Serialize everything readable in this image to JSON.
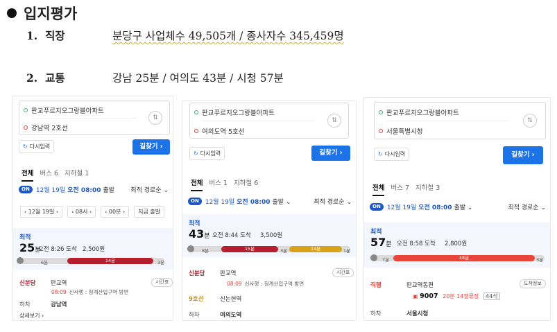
{
  "section": {
    "title": "입지평가"
  },
  "rows": [
    {
      "num": "1.",
      "label": "직장",
      "text": "분당구 사업체수 49,505개 / 종사자수 345,459명"
    },
    {
      "num": "2.",
      "label": "교통",
      "text": "강남 25분 / 여의도 43분 / 시청 57분"
    }
  ],
  "panels": [
    {
      "origin": "판교푸르지오그랑블아파트",
      "dest": "강남역 2호선",
      "reset": "다시입력",
      "find": "길찾기 ›",
      "tabs": [
        "전체",
        "버스 6",
        "지하철 1"
      ],
      "date": "12월 19일",
      "time": "오전 08:00",
      "suffix": "출발",
      "on": "ON",
      "sort": "최적 경로순 ⌄",
      "time_controls": [
        "‹  12월 19일  ›",
        "‹  08시  ›",
        "‹  00분  ›",
        "지금 출발"
      ],
      "best": "최적",
      "dur_num": "25",
      "dur_unit": "분",
      "arrive": "오전 8:26 도착",
      "fare": "2,500원",
      "seg_walk1": "6분",
      "seg_main": "14분",
      "seg_walk2": "3분",
      "main_color": "#b5202e",
      "stop1_line": "신분당",
      "stop1_name": "판교역",
      "stop1_chip": "시간표",
      "stop1_sub_time": "08:09",
      "stop1_sub": "신사행 : 청계산입구역 방면",
      "stop2_line": "하차",
      "stop2_name": "강남역",
      "more": "상세보기 ›"
    },
    {
      "origin": "판교푸르지오그랑블아파트",
      "dest": "여의도역 5호선",
      "reset": "다시입력",
      "find": "길찾기 ›",
      "tabs": [
        "전체",
        "버스 1",
        "지하철 6"
      ],
      "date": "12월 19일",
      "time": "오전 08:00",
      "suffix": "출발 ⌄",
      "on": "ON",
      "sort": "최적 경로순 ⌄",
      "best": "최적",
      "dur_num": "43",
      "dur_unit": "분",
      "arrive": "오전 8:44 도착",
      "fare": "3,500원",
      "seg_walk1": "8분",
      "seg_main": "15분",
      "seg_walk2": "3분",
      "seg_main2": "14분",
      "seg_walk3": "1분",
      "main_color": "#b5202e",
      "main2_color": "#d9a21b",
      "stop1_line": "신분당",
      "stop1_name": "판교역",
      "stop1_chip": "시간표",
      "stop1_sub_time": "08:09",
      "stop1_sub": "신사행 : 청계산입구역 방면",
      "stop2_line": "9호선",
      "stop2_name": "신논현역",
      "stop3_line": "하차",
      "stop3_name": "여의도역"
    },
    {
      "origin": "판교푸르지오그랑블아파트",
      "dest": "서울특별시청",
      "reset": "다시입력",
      "find": "길찾기 ›",
      "tabs": [
        "전체",
        "버스 7",
        "지하철 3"
      ],
      "date": "12월 19일",
      "time": "오전 08:00",
      "suffix": "출발 ⌄",
      "on": "ON",
      "sort": "최적 경로순 ⌄",
      "best": "최적",
      "dur_num": "57",
      "dur_unit": "분",
      "arrive": "오전 8:58 도착",
      "fare": "2,800원",
      "seg_walk1": "7분",
      "seg_main": "48분",
      "seg_walk2": "3분",
      "main_color": "#e8443a",
      "stop1_line": "직행",
      "stop1_name": "판교역동편",
      "stop1_chip": "도착정보",
      "bus_no": "9007",
      "bus_info": "20분 14정류장",
      "bus_seat": "44석",
      "stop2_line": "하차",
      "stop2_name": "서울시청"
    }
  ]
}
